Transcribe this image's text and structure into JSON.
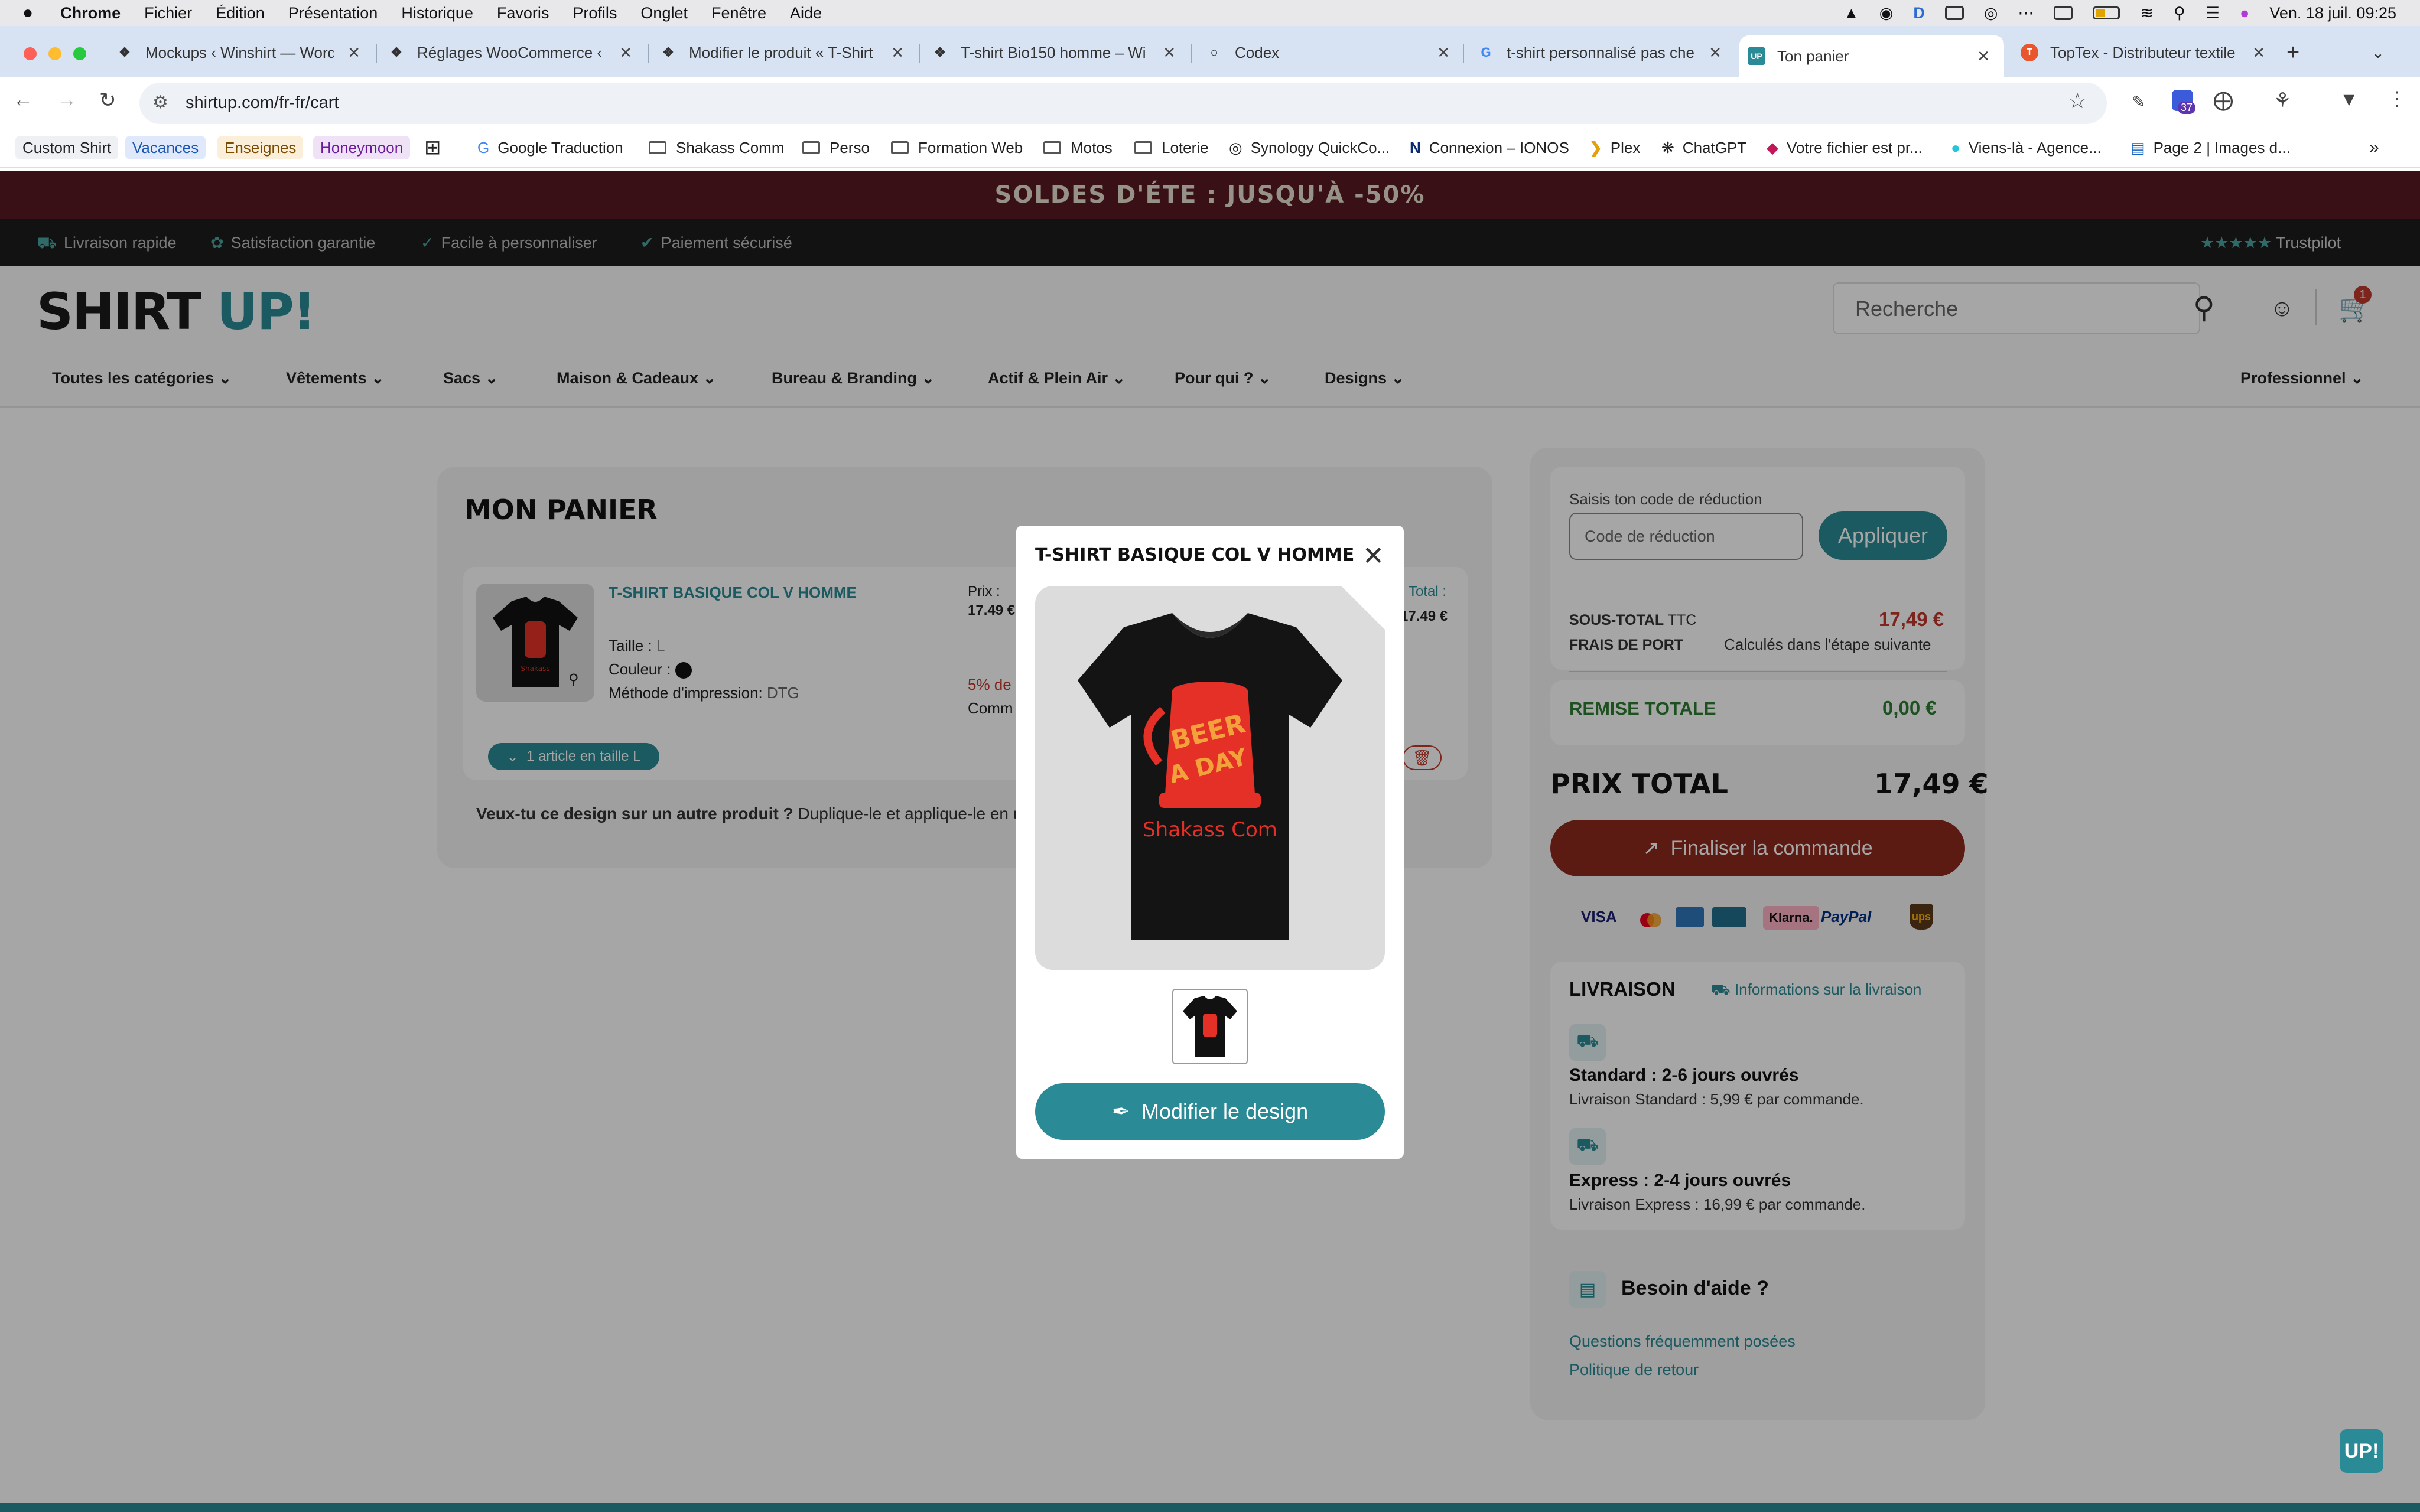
{
  "menubar": {
    "apple": "",
    "app": "Chrome",
    "items": [
      "Fichier",
      "Édition",
      "Présentation",
      "Historique",
      "Favoris",
      "Profils",
      "Onglet",
      "Fenêtre",
      "Aide"
    ],
    "clock": "Ven. 18 juil.  09:25",
    "badge": "37"
  },
  "tabs": [
    {
      "title": "Mockups ‹ Winshirt — Word",
      "icon": "wordpress-icon"
    },
    {
      "title": "Réglages WooCommerce ‹ W",
      "icon": "wordpress-icon"
    },
    {
      "title": "Modifier le produit « T-Shirt",
      "icon": "wordpress-icon"
    },
    {
      "title": "T-shirt Bio150 homme – Wi",
      "icon": "wordpress-icon"
    },
    {
      "title": "Codex",
      "icon": "codex-icon"
    },
    {
      "title": "t-shirt personnalisé pas che",
      "icon": "google-icon"
    },
    {
      "title": "Ton panier",
      "icon": "shirtup-icon"
    },
    {
      "title": "TopTex - Distributeur textile",
      "icon": "toptex-icon"
    }
  ],
  "toolbar": {
    "url": "shirtup.com/fr-fr/cart"
  },
  "bookmarks": {
    "chips": [
      "Custom Shirt",
      "Vacances",
      "Enseignes",
      "Honeymoon"
    ],
    "items": [
      "Google Traduction",
      "Shakass Comm",
      "Perso",
      "Formation Web",
      "Motos",
      "Loterie",
      "Synology QuickCo...",
      "Connexion – IONOS",
      "Plex",
      "ChatGPT",
      "Votre fichier est pr...",
      "Viens-là - Agence...",
      "Page 2 | Images d..."
    ]
  },
  "promo": "SOLDES D'ÉTE : JUSQU'À -50%",
  "assurances": [
    "Livraison rapide",
    "Satisfaction garantie",
    "Facile à personnaliser",
    "Paiement sécurisé"
  ],
  "trustpilot": "Trustpilot",
  "header": {
    "logo_a": "SHIRT",
    "logo_b": "UP!",
    "search_placeholder": "Recherche",
    "cart_count": "1"
  },
  "nav": [
    "Toutes les catégories",
    "Vêtements",
    "Sacs",
    "Maison & Cadeaux",
    "Bureau & Branding",
    "Actif & Plein Air",
    "Pour qui ?",
    "Designs",
    "Professionnel"
  ],
  "cart": {
    "title": "MON PANIER",
    "item_name": "T-SHIRT BASIQUE COL V HOMME",
    "size_label": "Taille :",
    "size_value": "L",
    "color_label": "Couleur :",
    "method_label": "Méthode d'impression:",
    "method_value": "DTG",
    "price_label": "Prix :",
    "price_value": "17.49 €",
    "total_label": "Total :",
    "total_value": "17.49 €",
    "discount_note": "5% de",
    "comm_note": "Comm",
    "size_button": "1 article en taille L",
    "dup_bold": "Veux-tu ce design sur un autre produit ?",
    "dup_text": "Duplique-le et applique-le en un"
  },
  "summary": {
    "code_label": "Saisis ton code de réduction",
    "code_placeholder": "Code de réduction",
    "apply": "Appliquer",
    "subtotal_label": "SOUS-TOTAL",
    "subtotal_ttc": "TTC",
    "subtotal_value": "17,49 €",
    "shipping_label": "FRAIS DE PORT",
    "shipping_value": "Calculés dans l'étape suivante",
    "discount_label": "REMISE TOTALE",
    "discount_value": "0,00 €",
    "total_label": "PRIX TOTAL",
    "total_value": "17,49 €",
    "checkout": "Finaliser la commande",
    "payments": [
      "VISA",
      "Klarna.",
      "PayPal",
      "ups"
    ],
    "delivery_title": "LIVRAISON",
    "delivery_info": "Informations sur la livraison",
    "std_title": "Standard : 2-6 jours ouvrés",
    "std_desc": "Livraison Standard : 5,99 € par commande.",
    "exp_title": "Express : 2-4 jours ouvrés",
    "exp_desc": "Livraison Express : 16,99 € par commande.",
    "help_title": "Besoin d'aide ?",
    "faq": "Questions fréquemment posées",
    "returns": "Politique de retour"
  },
  "modal": {
    "title": "T-SHIRT BASIQUE COL V HOMME",
    "print_brand": "Shakass Com",
    "button": "Modifier le design"
  },
  "fab": "UP!",
  "colors": {
    "brand_teal": "#2a8b96",
    "promo_bg": "#5a1a24",
    "checkout": "#8e2a1d",
    "price_red": "#c0392b",
    "discount_green": "#2e7d32"
  }
}
